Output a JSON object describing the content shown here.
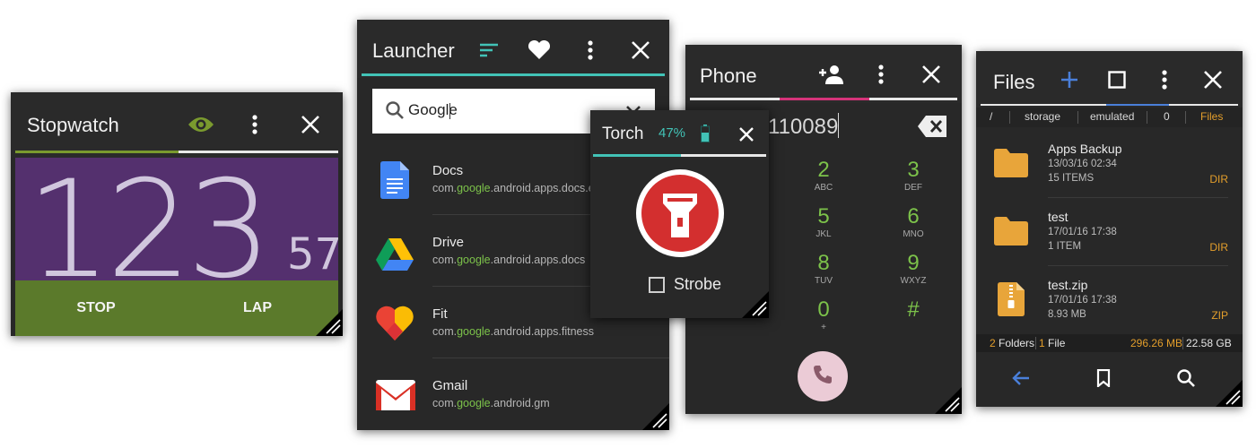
{
  "stopwatch": {
    "title": "Stopwatch",
    "time_main": "123",
    "time_sub": "57",
    "stop_label": "STOP",
    "lap_label": "LAP",
    "icons": [
      "eye-icon",
      "more-vert-icon",
      "close-icon",
      "resize-icon"
    ],
    "colors": {
      "accent": "#7a9a2e",
      "display": "#54306e",
      "buttons": "#5b7a2b"
    }
  },
  "launcher": {
    "title": "Launcher",
    "search_value": "Google",
    "icons": [
      "sort-icon",
      "heart-icon",
      "more-vert-icon",
      "close-icon",
      "search-icon",
      "chevron-down-icon",
      "resize-icon"
    ],
    "apps": [
      {
        "name": "Docs",
        "pkg_prefix": "com.",
        "pkg_hl": "google",
        "pkg_suffix": ".android.apps.docs.e",
        "icon": "docs-icon"
      },
      {
        "name": "Drive",
        "pkg_prefix": "com.",
        "pkg_hl": "google",
        "pkg_suffix": ".android.apps.docs",
        "icon": "drive-icon"
      },
      {
        "name": "Fit",
        "pkg_prefix": "com.",
        "pkg_hl": "google",
        "pkg_suffix": ".android.apps.fitness",
        "icon": "fit-icon"
      },
      {
        "name": "Gmail",
        "pkg_prefix": "com.",
        "pkg_hl": "google",
        "pkg_suffix": ".android.gm",
        "icon": "gmail-icon"
      }
    ],
    "colors": {
      "accent": "#42c3b7",
      "highlight": "#7cc24a"
    }
  },
  "torch": {
    "title": "Torch",
    "battery": "47%",
    "strobe_label": "Strobe",
    "icons": [
      "battery-icon",
      "close-icon",
      "flashlight-icon",
      "resize-icon"
    ],
    "colors": {
      "accent": "#42c3b7",
      "button": "#d32f2f"
    }
  },
  "phone": {
    "title": "Phone",
    "number": "110089",
    "keys": [
      {
        "num": "2",
        "letters": "ABC"
      },
      {
        "num": "3",
        "letters": "DEF"
      },
      {
        "num": "5",
        "letters": "JKL"
      },
      {
        "num": "6",
        "letters": "MNO"
      },
      {
        "num": "8",
        "letters": "TUV"
      },
      {
        "num": "9",
        "letters": "WXYZ"
      },
      {
        "num": "0",
        "letters": "+"
      },
      {
        "num": "#",
        "letters": ""
      }
    ],
    "icons": [
      "add-contact-icon",
      "more-vert-icon",
      "close-icon",
      "backspace-icon",
      "phone-icon",
      "resize-icon"
    ],
    "colors": {
      "accent": "#d6337a",
      "keys": "#7cc24a",
      "call": "#ebcbd6"
    }
  },
  "files": {
    "title": "Files",
    "breadcrumbs": [
      "/",
      "storage",
      "emulated",
      "0",
      "Files"
    ],
    "items": [
      {
        "name": "Apps Backup",
        "date": "13/03/16 02:34",
        "detail": "15 ITEMS",
        "type": "DIR",
        "icon": "folder-icon"
      },
      {
        "name": "test",
        "date": "17/01/16 17:38",
        "detail": "1 ITEM",
        "type": "DIR",
        "icon": "folder-icon"
      },
      {
        "name": "test.zip",
        "date": "17/01/16 17:38",
        "detail": "8.93 MB",
        "type": "ZIP",
        "icon": "zip-icon"
      }
    ],
    "status": {
      "folders_count": "2",
      "folders_label": "Folders",
      "files_count": "1",
      "files_label": "File",
      "used": "296.26 MB",
      "total": "22.58 GB"
    },
    "icons": [
      "add-icon",
      "select-icon",
      "more-vert-icon",
      "close-icon",
      "back-arrow-icon",
      "bookmark-icon",
      "search-icon",
      "resize-icon"
    ],
    "colors": {
      "accent": "#4a7fd9",
      "orange": "#e39e2b"
    }
  }
}
